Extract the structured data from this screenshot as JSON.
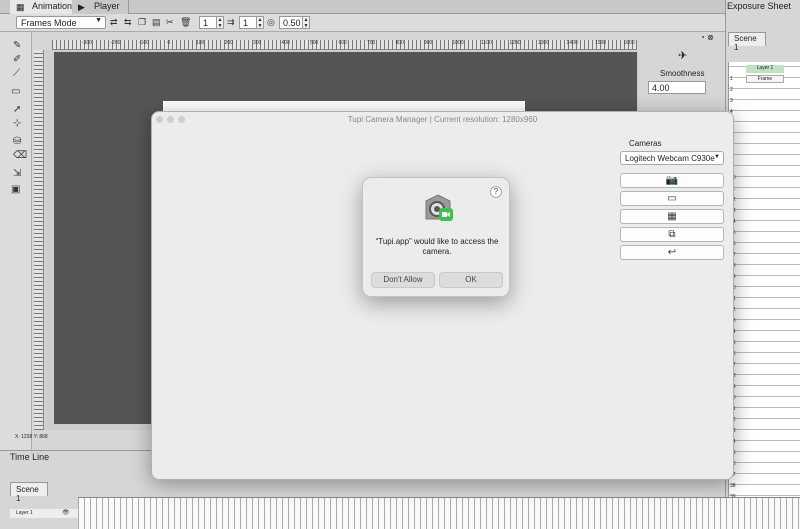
{
  "tabs": [
    {
      "label": "Animation",
      "icon": "film-icon"
    },
    {
      "label": "Player",
      "icon": "play-icon"
    }
  ],
  "toolbar": {
    "mode": "Frames Mode",
    "value1": "1",
    "value2": "1",
    "opacity": "0.50"
  },
  "ruler": {
    "labels": [
      "-300",
      "-200",
      "-100",
      "0",
      "100",
      "200",
      "300",
      "400",
      "500",
      "600",
      "700",
      "800",
      "900",
      "1000",
      "1100",
      "1200",
      "1300",
      "1400",
      "1500",
      "1600"
    ]
  },
  "properties": {
    "smoothness_label": "Smoothness",
    "smoothness_value": "4.00"
  },
  "exposure": {
    "title": "Exposure Sheet",
    "scene_tab": "Scene 1",
    "layer": "Layer 1",
    "frame": "Frame",
    "row_numbers": [
      "1",
      "2",
      "3",
      "4",
      "5",
      "6",
      "7",
      "8",
      "9",
      "10",
      "11",
      "12",
      "13",
      "14",
      "15",
      "16",
      "17",
      "18",
      "19",
      "20",
      "21",
      "22",
      "23",
      "24",
      "25",
      "26",
      "27",
      "28",
      "29",
      "30",
      "31",
      "32",
      "33",
      "34",
      "35",
      "36",
      "37",
      "38",
      "39",
      "40",
      "41",
      "42"
    ]
  },
  "status": {
    "coords": "X: 1238 Y: 868"
  },
  "timeline": {
    "title": "Time Line",
    "scene_tab": "Scene 1",
    "layer": "Layer 1"
  },
  "camera_window": {
    "title": "Tupi Camera Manager | Current resolution: 1280x960",
    "cameras_label": "Cameras",
    "camera_selected": "Logitech Webcam C930e"
  },
  "dialog": {
    "message": "“Tupi.app” would like to access the camera.",
    "help": "?",
    "deny": "Don't Allow",
    "ok": "OK"
  }
}
